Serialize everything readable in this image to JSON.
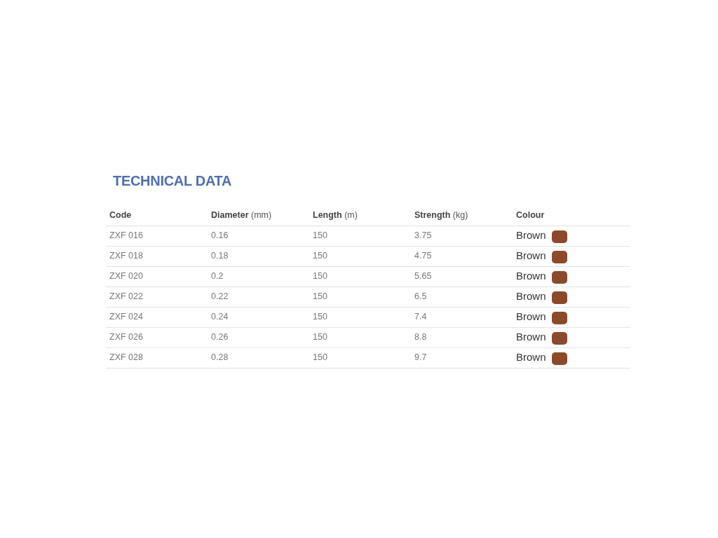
{
  "title": "TECHNICAL DATA",
  "table": {
    "columns": [
      "**Code**",
      "**Diameter** (mm)",
      "**Length** (m)",
      "**Strength** (kg)",
      "**Colour**"
    ],
    "rows": [
      {
        "code": "ZXF 016",
        "diameter": "0.16",
        "length": "150",
        "strength": "3.75",
        "colour": "Brown",
        "color": "#8b4a2b"
      },
      {
        "code": "ZXF 018",
        "diameter": "0.18",
        "length": "150",
        "strength": "4.75",
        "colour": "Brown",
        "color": "#8b4a2b"
      },
      {
        "code": "ZXF 020",
        "diameter": "0.2",
        "length": "150",
        "strength": "5.65",
        "colour": "Brown",
        "color": "#8b4a2b"
      },
      {
        "code": "ZXF 022",
        "diameter": "0.22",
        "length": "150",
        "strength": "6.5",
        "colour": "Brown",
        "color": "#8b4a2b"
      },
      {
        "code": "ZXF 024",
        "diameter": "0.24",
        "length": "150",
        "strength": "7.4",
        "colour": "Brown",
        "color": "#8b4a2b"
      },
      {
        "code": "ZXF 026",
        "diameter": "0.26",
        "length": "150",
        "strength": "8.8",
        "colour": "Brown",
        "color": "#8b4a2b"
      },
      {
        "code": "ZXF 028",
        "diameter": "0.28",
        "length": "150",
        "strength": "9.7",
        "colour": "Brown",
        "color": "#8b4a2b"
      }
    ]
  }
}
